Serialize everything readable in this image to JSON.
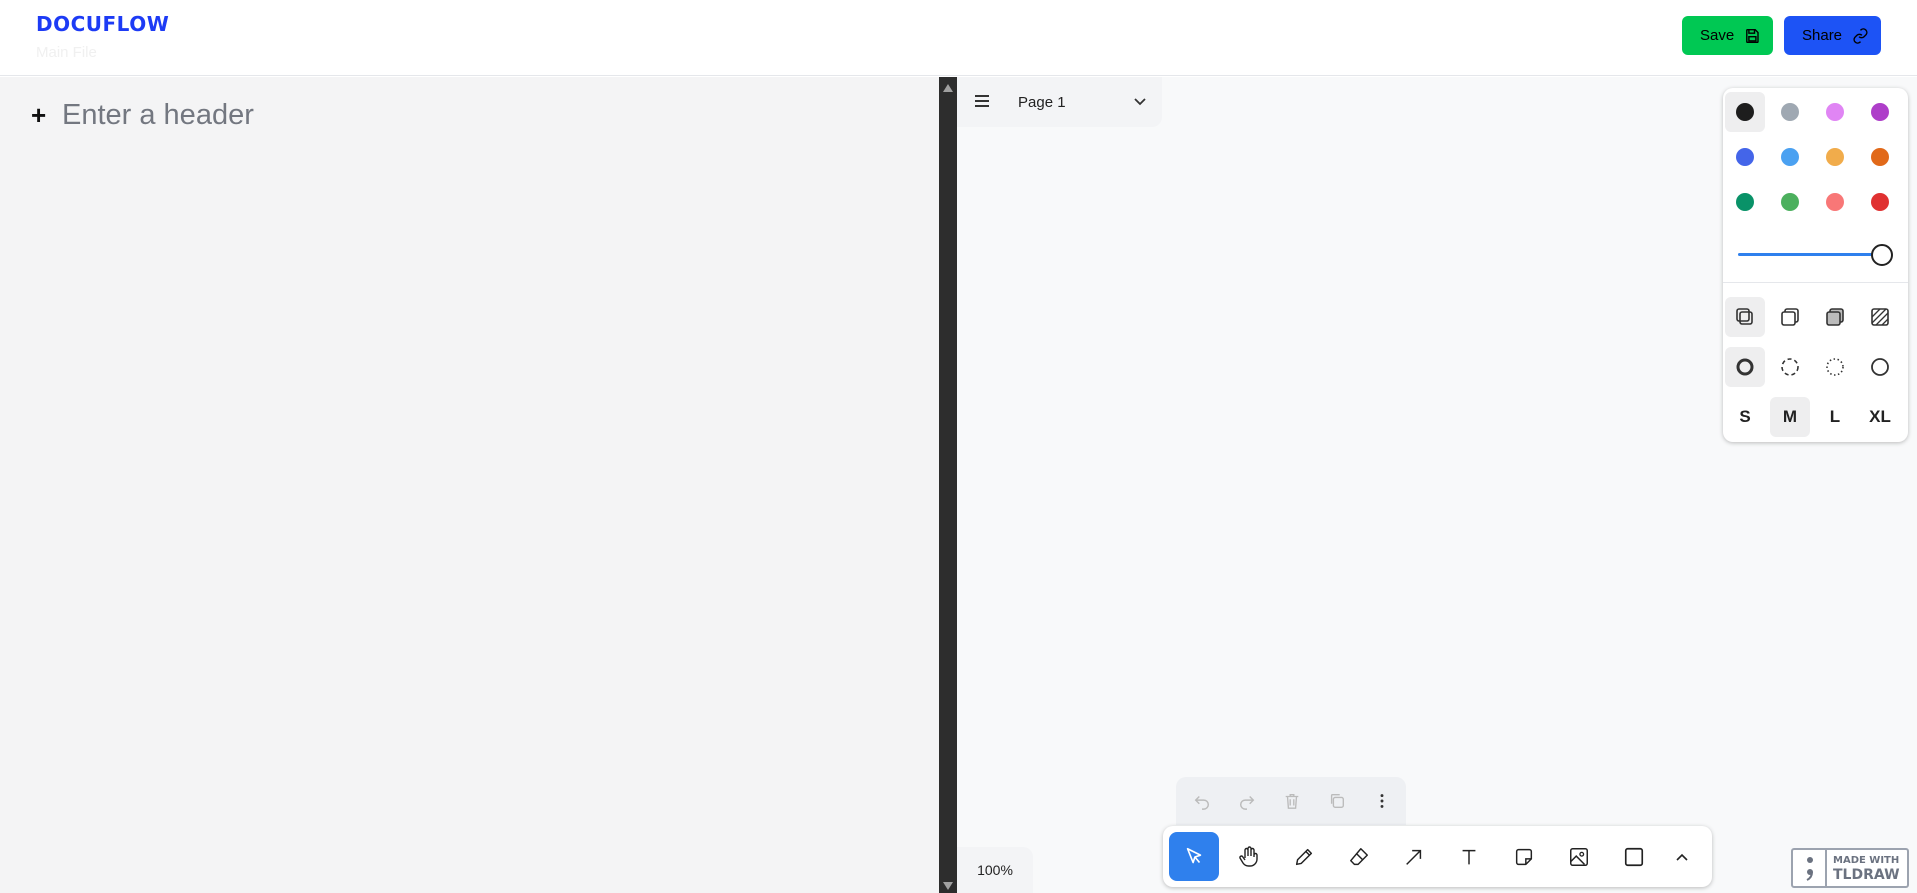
{
  "app": {
    "logo": "DOCUFLOW",
    "subtitle": "Main File"
  },
  "header_buttons": {
    "save_label": "Save",
    "share_label": "Share"
  },
  "editor": {
    "header_placeholder": "Enter a header"
  },
  "page_menu": {
    "current_page": "Page 1"
  },
  "style_panel": {
    "colors": [
      {
        "name": "black",
        "hex": "#1d1d1d",
        "selected": true
      },
      {
        "name": "grey",
        "hex": "#9fa8b2"
      },
      {
        "name": "light-violet",
        "hex": "#e085f4"
      },
      {
        "name": "violet",
        "hex": "#ae3ec9"
      },
      {
        "name": "blue",
        "hex": "#4465e9"
      },
      {
        "name": "light-blue",
        "hex": "#4ba1f1"
      },
      {
        "name": "yellow",
        "hex": "#f1ac4b"
      },
      {
        "name": "orange",
        "hex": "#e16919"
      },
      {
        "name": "green",
        "hex": "#099268"
      },
      {
        "name": "light-green",
        "hex": "#4cb05e"
      },
      {
        "name": "light-red",
        "hex": "#f87777"
      },
      {
        "name": "red",
        "hex": "#e03131"
      }
    ],
    "opacity": 1.0,
    "fill_options": [
      "none-fill-icon",
      "semi-fill-icon",
      "solid-fill-icon",
      "pattern-fill-icon"
    ],
    "dash_options": [
      "draw-dash-icon",
      "dashed-dash-icon",
      "dotted-dash-icon",
      "solid-dash-icon"
    ],
    "sizes": [
      "S",
      "M",
      "L",
      "XL"
    ],
    "selected_size": "M"
  },
  "zoom": {
    "level": "100%"
  },
  "tools": [
    "select-tool",
    "hand-tool",
    "draw-tool",
    "eraser-tool",
    "arrow-tool",
    "text-tool",
    "note-tool",
    "image-tool",
    "rectangle-tool",
    "more-tools"
  ],
  "watermark": {
    "line1": "MADE WITH",
    "line2": "TLDRAW"
  }
}
